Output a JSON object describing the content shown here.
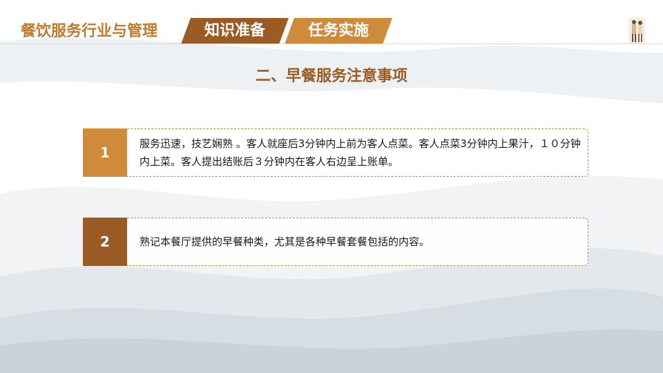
{
  "header": {
    "course_title": "餐饮服务行业与管理",
    "tabs": [
      {
        "label": "知识准备",
        "color": "#9a5c24"
      },
      {
        "label": "任务实施",
        "color": "#cf8a3a"
      }
    ]
  },
  "section": {
    "title": "二、早餐服务注意事项"
  },
  "items": [
    {
      "number": "1",
      "text": "服务迅速，技艺娴熟 。客人就座后3分钟内上前为客人点菜。客人点菜3分钟内上果汁，１０分钟内上菜。客人提出结账后３分钟内在客人右边呈上账单。"
    },
    {
      "number": "2",
      "text": "熟记本餐厅提供的早餐种类，尤其是各种早餐套餐包括的内容。"
    }
  ],
  "colors": {
    "accent_dark": "#9a5c24",
    "accent_light": "#cf8a3a",
    "title_brown": "#c07b2c"
  }
}
